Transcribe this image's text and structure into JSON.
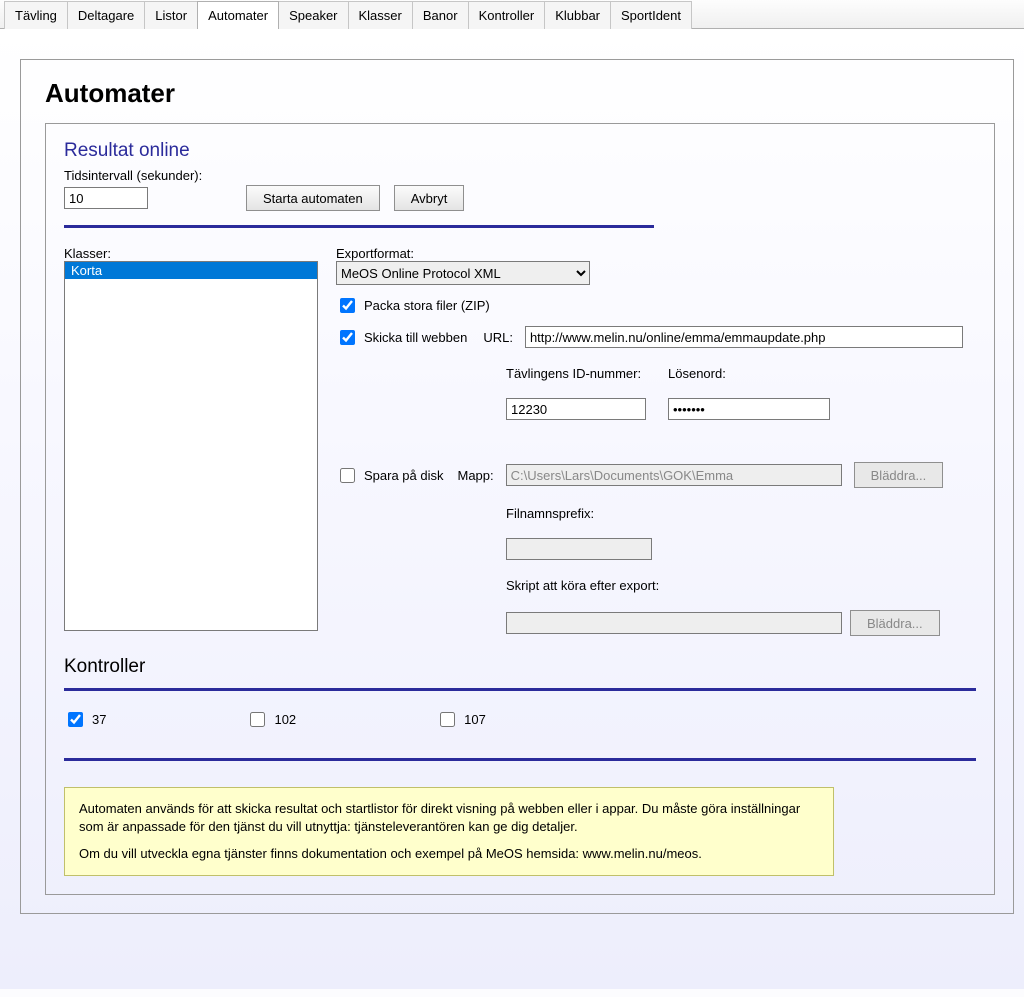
{
  "tabs": [
    "Tävling",
    "Deltagare",
    "Listor",
    "Automater",
    "Speaker",
    "Klasser",
    "Banor",
    "Kontroller",
    "Klubbar",
    "SportIdent"
  ],
  "active_tab": 3,
  "page_title": "Automater",
  "section_title": "Resultat online",
  "interval_label": "Tidsintervall (sekunder):",
  "interval_value": "10",
  "start_button": "Starta automaten",
  "cancel_button": "Avbryt",
  "klasser_label": "Klasser:",
  "klasser_items": [
    "Korta"
  ],
  "export": {
    "label": "Exportformat:",
    "selected": "MeOS Online Protocol XML",
    "zip_checked": true,
    "zip_label": "Packa stora filer (ZIP)",
    "web_checked": true,
    "web_label": "Skicka till webben",
    "url_label": "URL:",
    "url_value": "http://www.melin.nu/online/emma/emmaupdate.php",
    "comp_id_label": "Tävlingens ID-nummer:",
    "comp_id_value": "12230",
    "password_label": "Lösenord:",
    "password_value": "•••••••",
    "disk_checked": false,
    "disk_label": "Spara på disk",
    "folder_label": "Mapp:",
    "folder_value": "C:\\Users\\Lars\\Documents\\GOK\\Emma",
    "browse_label": "Bläddra...",
    "prefix_label": "Filnamnsprefix:",
    "prefix_value": "",
    "script_label": "Skript att köra efter export:",
    "script_value": ""
  },
  "kontroller": {
    "title": "Kontroller",
    "items": [
      {
        "label": "37",
        "checked": true
      },
      {
        "label": "102",
        "checked": false
      },
      {
        "label": "107",
        "checked": false
      }
    ]
  },
  "info": {
    "p1": "Automaten används för att skicka resultat och startlistor för direkt visning på webben eller i appar. Du måste göra inställningar som är anpassade för den tjänst du vill utnyttja: tjänsteleverantören kan ge dig detaljer.",
    "p2": "Om du vill utveckla egna tjänster finns dokumentation och exempel på MeOS hemsida: www.melin.nu/meos."
  }
}
